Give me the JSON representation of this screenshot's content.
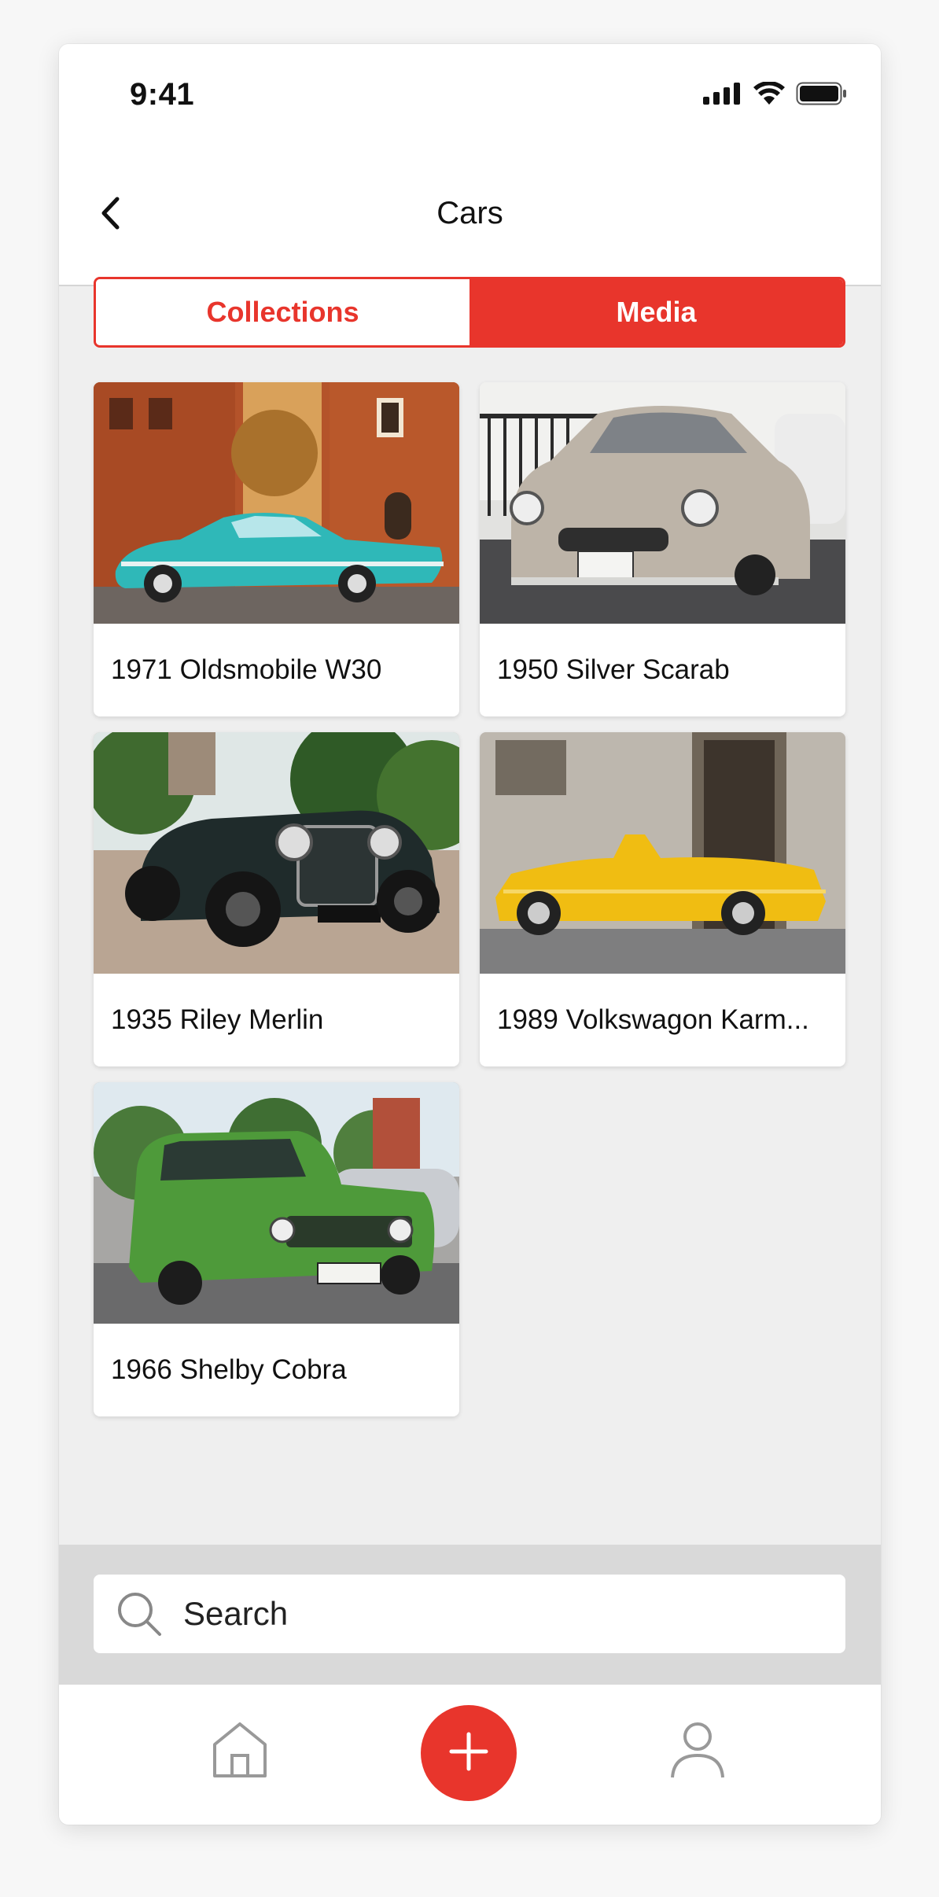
{
  "status_bar": {
    "time": "9:41",
    "icons": [
      "signal-icon",
      "wifi-icon",
      "battery-icon"
    ]
  },
  "nav": {
    "title": "Cars",
    "back_icon": "chevron-left-icon"
  },
  "segments": {
    "items": [
      {
        "label": "Collections",
        "selected": false
      },
      {
        "label": "Media",
        "selected": true
      }
    ]
  },
  "cards": [
    {
      "title": "1971 Oldsmobile W30",
      "image": "turquoise-classic-car-photo"
    },
    {
      "title": "1950 Silver Scarab",
      "image": "beige-classic-car-photo"
    },
    {
      "title": "1935 Riley Merlin",
      "image": "dark-green-vintage-car-photo"
    },
    {
      "title": "1989 Volkswagon Karm...",
      "image": "yellow-convertible-photo"
    },
    {
      "title": "1966 Shelby Cobra",
      "image": "green-hatchback-photo"
    }
  ],
  "search": {
    "placeholder": "Search",
    "icon": "search-icon"
  },
  "tab_bar": {
    "items": [
      "home-icon",
      "plus-icon",
      "profile-icon"
    ]
  },
  "colors": {
    "accent": "#e8352c",
    "background": "#efefef",
    "search_area": "#d9d9d9"
  }
}
